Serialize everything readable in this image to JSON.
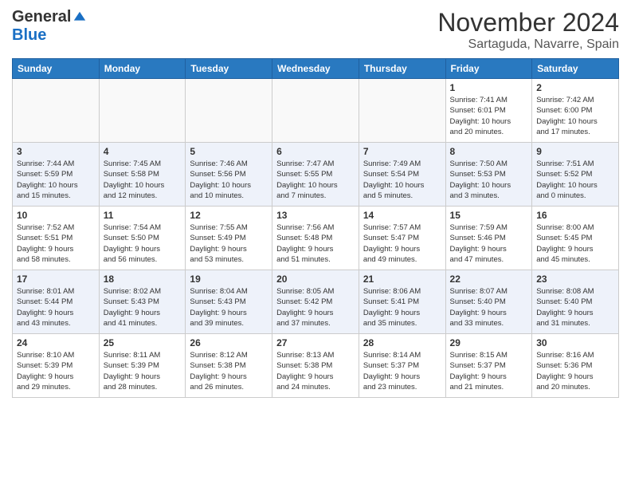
{
  "header": {
    "logo_general": "General",
    "logo_blue": "Blue",
    "month_title": "November 2024",
    "location": "Sartaguda, Navarre, Spain"
  },
  "weekdays": [
    "Sunday",
    "Monday",
    "Tuesday",
    "Wednesday",
    "Thursday",
    "Friday",
    "Saturday"
  ],
  "weeks": [
    [
      {
        "day": "",
        "info": ""
      },
      {
        "day": "",
        "info": ""
      },
      {
        "day": "",
        "info": ""
      },
      {
        "day": "",
        "info": ""
      },
      {
        "day": "",
        "info": ""
      },
      {
        "day": "1",
        "info": "Sunrise: 7:41 AM\nSunset: 6:01 PM\nDaylight: 10 hours\nand 20 minutes."
      },
      {
        "day": "2",
        "info": "Sunrise: 7:42 AM\nSunset: 6:00 PM\nDaylight: 10 hours\nand 17 minutes."
      }
    ],
    [
      {
        "day": "3",
        "info": "Sunrise: 7:44 AM\nSunset: 5:59 PM\nDaylight: 10 hours\nand 15 minutes."
      },
      {
        "day": "4",
        "info": "Sunrise: 7:45 AM\nSunset: 5:58 PM\nDaylight: 10 hours\nand 12 minutes."
      },
      {
        "day": "5",
        "info": "Sunrise: 7:46 AM\nSunset: 5:56 PM\nDaylight: 10 hours\nand 10 minutes."
      },
      {
        "day": "6",
        "info": "Sunrise: 7:47 AM\nSunset: 5:55 PM\nDaylight: 10 hours\nand 7 minutes."
      },
      {
        "day": "7",
        "info": "Sunrise: 7:49 AM\nSunset: 5:54 PM\nDaylight: 10 hours\nand 5 minutes."
      },
      {
        "day": "8",
        "info": "Sunrise: 7:50 AM\nSunset: 5:53 PM\nDaylight: 10 hours\nand 3 minutes."
      },
      {
        "day": "9",
        "info": "Sunrise: 7:51 AM\nSunset: 5:52 PM\nDaylight: 10 hours\nand 0 minutes."
      }
    ],
    [
      {
        "day": "10",
        "info": "Sunrise: 7:52 AM\nSunset: 5:51 PM\nDaylight: 9 hours\nand 58 minutes."
      },
      {
        "day": "11",
        "info": "Sunrise: 7:54 AM\nSunset: 5:50 PM\nDaylight: 9 hours\nand 56 minutes."
      },
      {
        "day": "12",
        "info": "Sunrise: 7:55 AM\nSunset: 5:49 PM\nDaylight: 9 hours\nand 53 minutes."
      },
      {
        "day": "13",
        "info": "Sunrise: 7:56 AM\nSunset: 5:48 PM\nDaylight: 9 hours\nand 51 minutes."
      },
      {
        "day": "14",
        "info": "Sunrise: 7:57 AM\nSunset: 5:47 PM\nDaylight: 9 hours\nand 49 minutes."
      },
      {
        "day": "15",
        "info": "Sunrise: 7:59 AM\nSunset: 5:46 PM\nDaylight: 9 hours\nand 47 minutes."
      },
      {
        "day": "16",
        "info": "Sunrise: 8:00 AM\nSunset: 5:45 PM\nDaylight: 9 hours\nand 45 minutes."
      }
    ],
    [
      {
        "day": "17",
        "info": "Sunrise: 8:01 AM\nSunset: 5:44 PM\nDaylight: 9 hours\nand 43 minutes."
      },
      {
        "day": "18",
        "info": "Sunrise: 8:02 AM\nSunset: 5:43 PM\nDaylight: 9 hours\nand 41 minutes."
      },
      {
        "day": "19",
        "info": "Sunrise: 8:04 AM\nSunset: 5:43 PM\nDaylight: 9 hours\nand 39 minutes."
      },
      {
        "day": "20",
        "info": "Sunrise: 8:05 AM\nSunset: 5:42 PM\nDaylight: 9 hours\nand 37 minutes."
      },
      {
        "day": "21",
        "info": "Sunrise: 8:06 AM\nSunset: 5:41 PM\nDaylight: 9 hours\nand 35 minutes."
      },
      {
        "day": "22",
        "info": "Sunrise: 8:07 AM\nSunset: 5:40 PM\nDaylight: 9 hours\nand 33 minutes."
      },
      {
        "day": "23",
        "info": "Sunrise: 8:08 AM\nSunset: 5:40 PM\nDaylight: 9 hours\nand 31 minutes."
      }
    ],
    [
      {
        "day": "24",
        "info": "Sunrise: 8:10 AM\nSunset: 5:39 PM\nDaylight: 9 hours\nand 29 minutes."
      },
      {
        "day": "25",
        "info": "Sunrise: 8:11 AM\nSunset: 5:39 PM\nDaylight: 9 hours\nand 28 minutes."
      },
      {
        "day": "26",
        "info": "Sunrise: 8:12 AM\nSunset: 5:38 PM\nDaylight: 9 hours\nand 26 minutes."
      },
      {
        "day": "27",
        "info": "Sunrise: 8:13 AM\nSunset: 5:38 PM\nDaylight: 9 hours\nand 24 minutes."
      },
      {
        "day": "28",
        "info": "Sunrise: 8:14 AM\nSunset: 5:37 PM\nDaylight: 9 hours\nand 23 minutes."
      },
      {
        "day": "29",
        "info": "Sunrise: 8:15 AM\nSunset: 5:37 PM\nDaylight: 9 hours\nand 21 minutes."
      },
      {
        "day": "30",
        "info": "Sunrise: 8:16 AM\nSunset: 5:36 PM\nDaylight: 9 hours\nand 20 minutes."
      }
    ]
  ]
}
